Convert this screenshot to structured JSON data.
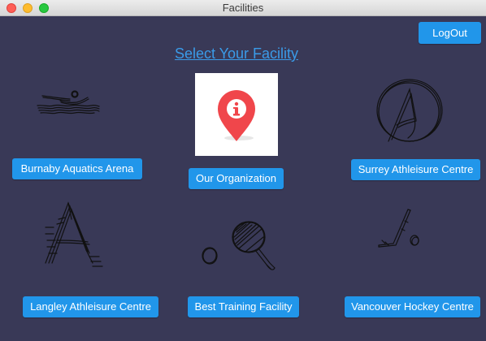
{
  "window": {
    "title": "Facilities"
  },
  "header": {
    "title": "Select Your Facility",
    "logout_label": "LogOut"
  },
  "facilities": {
    "burnaby": {
      "label": "Burnaby Aquatics Arena",
      "icon": "swimmer-icon"
    },
    "organization": {
      "label": "Our Organization",
      "icon": "info-location-pin-icon"
    },
    "surrey": {
      "label": "Surrey Athleisure Centre",
      "icon": "circled-a-icon"
    },
    "langley": {
      "label": "Langley Athleisure Centre",
      "icon": "letter-a-icon"
    },
    "best": {
      "label": "Best Training Facility",
      "icon": "ping-pong-icon"
    },
    "hockey": {
      "label": "Vancouver Hockey Centre",
      "icon": "hockey-stick-icon"
    }
  },
  "colors": {
    "background": "#393957",
    "button": "#2196ea",
    "heading": "#3a9be8",
    "pin": "#f0464b"
  }
}
